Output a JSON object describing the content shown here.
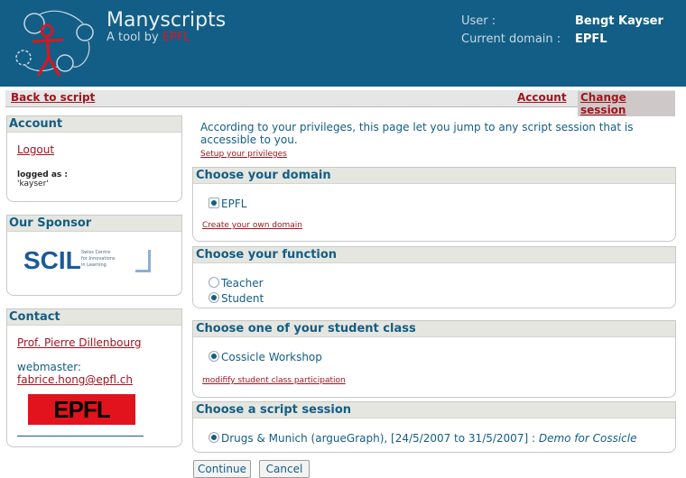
{
  "header": {
    "title": "Manyscripts",
    "subtitle_prefix": "A tool by ",
    "subtitle_brand": "EPFL",
    "user_label": "User :",
    "user_value": "Bengt Kayser",
    "domain_label": "Current domain :",
    "domain_value": "EPFL"
  },
  "nav": {
    "back": "Back to script",
    "account": "Account",
    "change_session": "Change session"
  },
  "sidebar": {
    "account": {
      "title": "Account",
      "logout": "Logout",
      "logged_as": "logged as :",
      "username": "'kayser'"
    },
    "sponsor": {
      "title": "Our Sponsor",
      "logo_text": "SCIL",
      "logo_caption": [
        "Swiss Centre",
        "for Innovations",
        "in Learning"
      ]
    },
    "contact": {
      "title": "Contact",
      "person": "Prof. Pierre Dillenbourg",
      "webmaster_label": "webmaster:",
      "webmaster_email": "fabrice.hong@epfl.ch",
      "logo_text": "EPFL"
    }
  },
  "main": {
    "intro": "According to your privileges, this page let you jump to any script session that is accessible to you.",
    "setup_link": "Setup your privileges",
    "domain": {
      "title": "Choose your domain",
      "option": "EPFL",
      "link": "Create your own domain"
    },
    "function": {
      "title": "Choose your function",
      "options": [
        "Teacher",
        "Student"
      ],
      "selected": "Student"
    },
    "class": {
      "title": "Choose one of your student class",
      "option": "Cossicle Workshop",
      "link": "modifify student class participation"
    },
    "session": {
      "title": "Choose a script session",
      "option": "Drugs & Munich (argueGraph), [24/5/2007 to 31/5/2007] :",
      "option_note": "Demo for Cossicle"
    },
    "buttons": {
      "continue": "Continue",
      "cancel": "Cancel"
    }
  },
  "colors": {
    "header_bg": "#125e86",
    "link": "#a3141e",
    "accent": "#125e86"
  }
}
